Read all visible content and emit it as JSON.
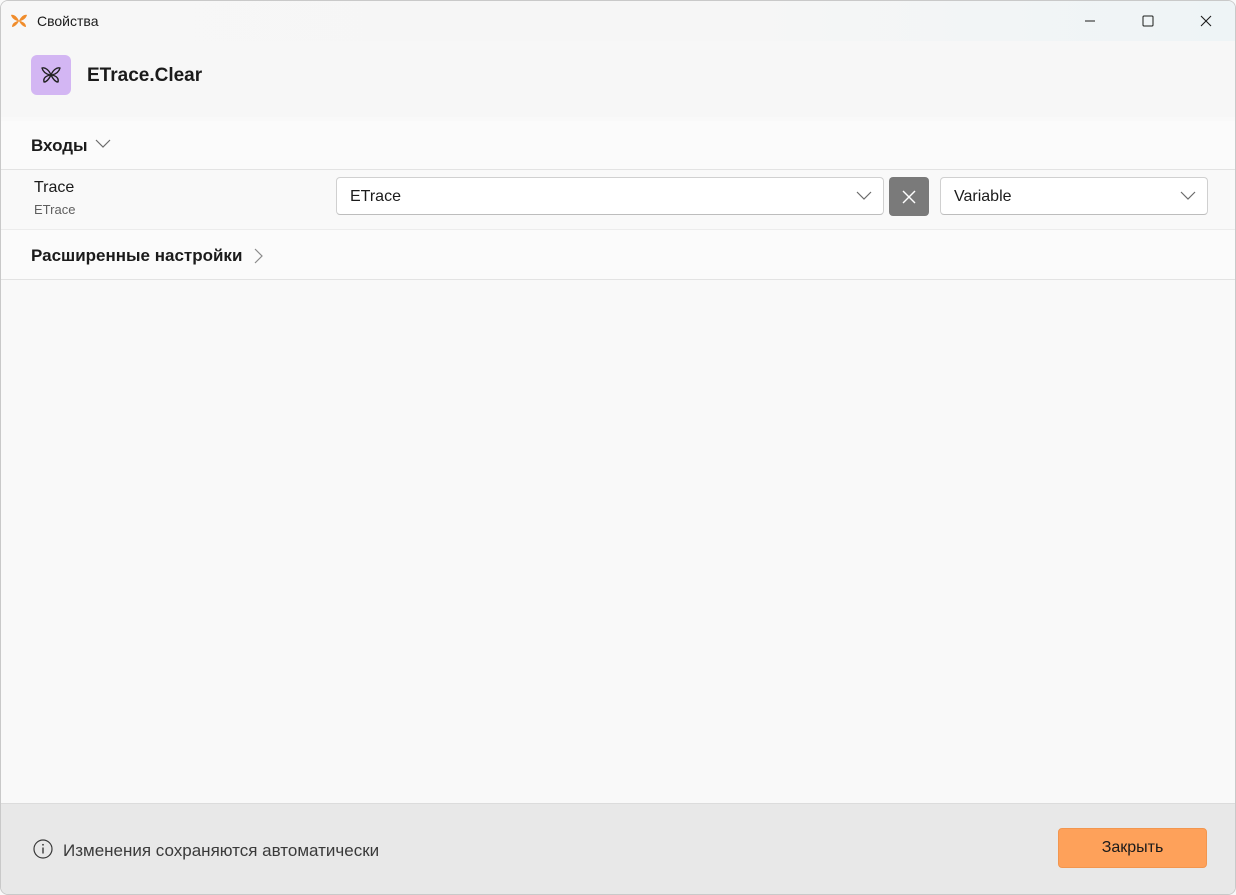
{
  "window": {
    "title": "Свойства"
  },
  "header": {
    "activity_title": "ETrace.Clear",
    "icon_color": "#d3b6f3"
  },
  "sections": {
    "inputs_label": "Входы",
    "advanced_label": "Расширенные настройки"
  },
  "properties": [
    {
      "name": "Trace",
      "type": "ETrace",
      "value": "ETrace",
      "mode": "Variable"
    }
  ],
  "footer": {
    "note": "Изменения сохраняются автоматически",
    "close_label": "Закрыть",
    "accent_color": "#fea15a"
  }
}
